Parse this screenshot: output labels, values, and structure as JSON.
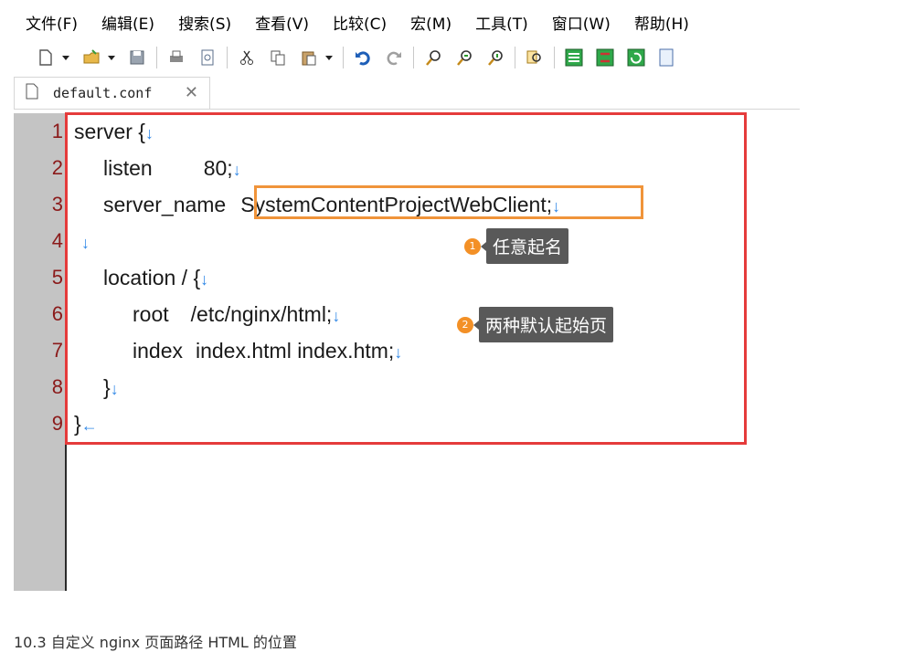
{
  "menu": [
    "文件(F)",
    "编辑(E)",
    "搜索(S)",
    "查看(V)",
    "比较(C)",
    "宏(M)",
    "工具(T)",
    "窗口(W)",
    "帮助(H)"
  ],
  "toolbar_icons": [
    "new-file-icon",
    "dropdown-icon",
    "open-folder-icon",
    "dropdown-icon",
    "save-icon",
    "print-icon",
    "print-preview-icon",
    "cut-icon",
    "copy-icon",
    "paste-icon",
    "dropdown-icon",
    "undo-icon",
    "redo-icon",
    "find-icon",
    "find-next-icon",
    "find-prev-icon",
    "find-in-files-icon",
    "wrap-icon",
    "sync-scroll-icon",
    "refresh-icon"
  ],
  "tab": {
    "filename": "default.conf",
    "close": "✕"
  },
  "line_numbers": [
    "1",
    "2",
    "3",
    "4",
    "5",
    "6",
    "7",
    "8",
    "9"
  ],
  "code": {
    "l1": "server {",
    "l2a": "listen",
    "l2b": "80;",
    "l3a": "server_name",
    "l3b": "SystemContentProjectWebClient;",
    "l5": "location / {",
    "l6a": "root",
    "l6b": "/etc/nginx/html;",
    "l7a": "index",
    "l7b": "index.html index.htm;",
    "l8": "}",
    "l9": "}",
    "newline_mark": "↓",
    "end_mark": "←"
  },
  "annotations": [
    {
      "num": "1",
      "text": "任意起名"
    },
    {
      "num": "2",
      "text": "两种默认起始页"
    }
  ],
  "bottom_caption": "10.3 自定义 nginx 页面路径 HTML 的位置",
  "colors": {
    "red_box": "#e53b3b",
    "orange_box": "#f0943a",
    "line_number": "#8b1a1a",
    "newline_mark": "#2f87e6"
  }
}
